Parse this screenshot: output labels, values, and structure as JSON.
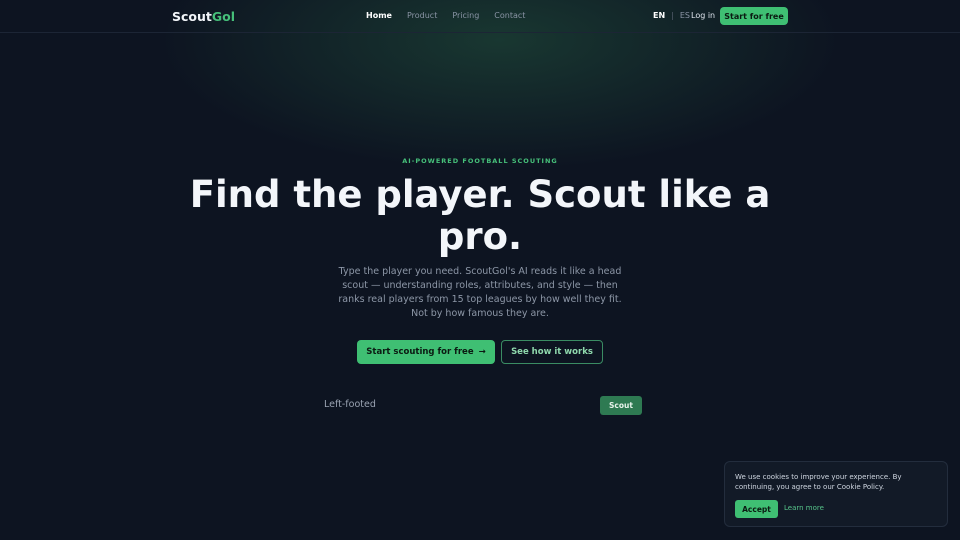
{
  "nav": {
    "logo_main": "Scout",
    "logo_accent": "Gol",
    "links": [
      "Home",
      "Product",
      "Pricing",
      "Contact"
    ],
    "lang_en": "EN",
    "lang_sep": "|",
    "lang_es": "ES",
    "login": "Log in",
    "cta": "Start for free"
  },
  "hero": {
    "eyebrow": "AI-POWERED FOOTBALL SCOUTING",
    "headline": "Find the player. Scout like a pro.",
    "subtext": "Type the player you need. ScoutGol's AI reads it like a head scout — understanding roles, attributes, and style — then ranks real players from 15 top leagues by how well they fit. Not by how famous they are.",
    "primary_cta": "Start scouting for free",
    "primary_cta_arrow": "→",
    "secondary_cta": "See how it works"
  },
  "search": {
    "value": "Left-footed",
    "button": "Scout"
  },
  "cookie": {
    "text": "We use cookies to improve your experience. By continuing, you agree to our Cookie Policy.",
    "accept": "Accept",
    "learn_more": "Learn more"
  },
  "colors": {
    "background": "#0d1421",
    "accent": "#3fbf73",
    "accent_text": "#46c07a"
  }
}
